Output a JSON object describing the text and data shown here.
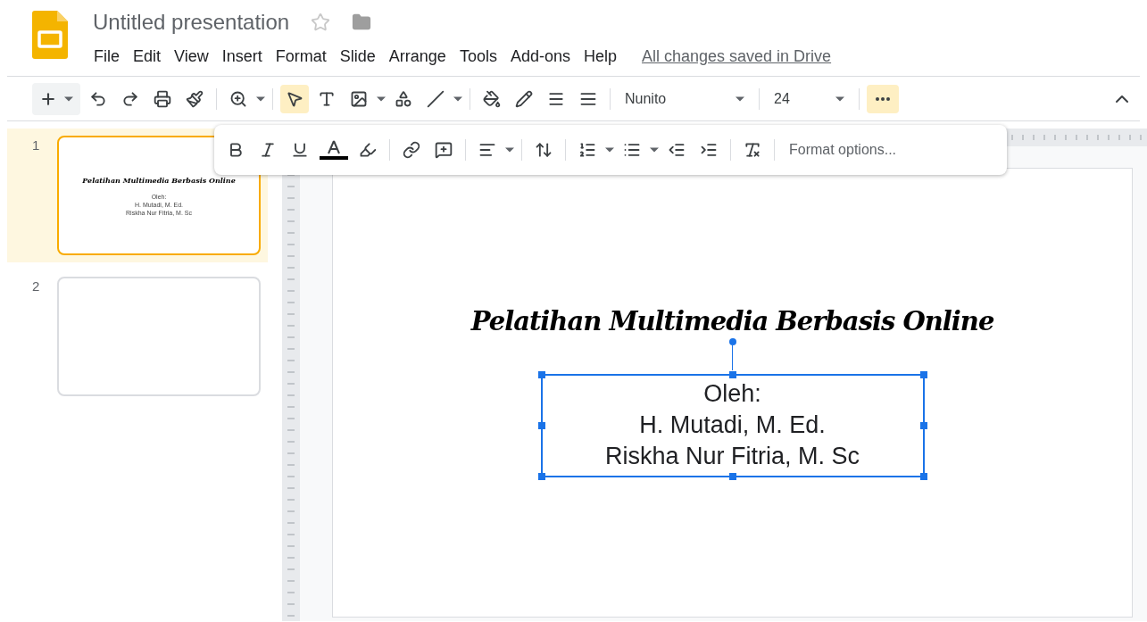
{
  "document": {
    "title": "Untitled presentation",
    "starred": false,
    "save_status": "All changes saved in Drive"
  },
  "menu": [
    "File",
    "Edit",
    "View",
    "Insert",
    "Format",
    "Slide",
    "Arrange",
    "Tools",
    "Add-ons",
    "Help"
  ],
  "toolbar": {
    "select_tool": {
      "selected": true
    },
    "font": "Nunito",
    "font_size": "24",
    "more_button": {
      "selected": true
    }
  },
  "format_toolbar": {
    "options_label": "Format options..."
  },
  "slides": [
    {
      "number": "1",
      "selected": true,
      "title": "Pelatihan Multimedia Berbasis Online",
      "lines": [
        "Oleh:",
        "H. Mutadi, M. Ed.",
        "Riskha Nur Fitria, M. Sc"
      ]
    },
    {
      "number": "2",
      "selected": false
    }
  ],
  "canvas": {
    "title": "Pelatihan Multimedia Berbasis Online",
    "text_box": {
      "selected": true,
      "lines": [
        "Oleh:",
        "H. Mutadi, M. Ed.",
        "Riskha Nur Fitria, M. Sc"
      ]
    }
  }
}
